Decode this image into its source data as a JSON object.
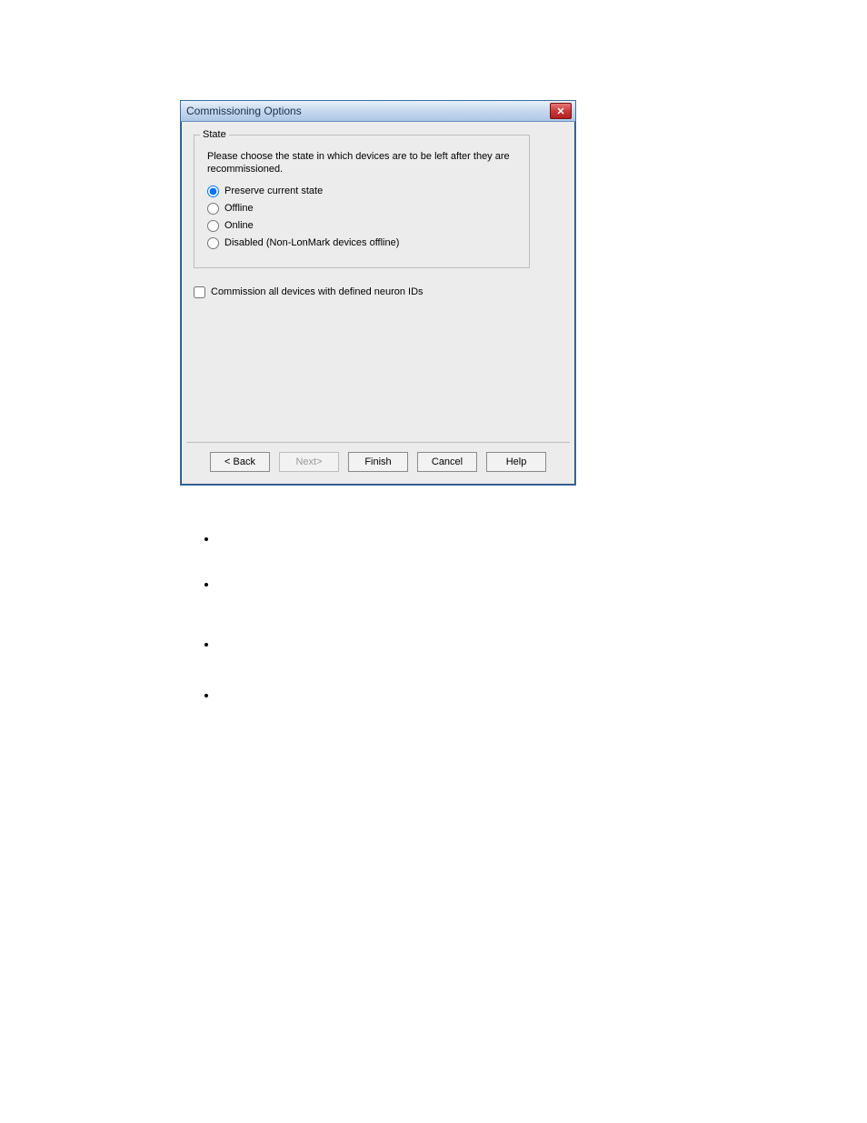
{
  "dialog": {
    "title": "Commissioning Options",
    "close_aria": "Close"
  },
  "group": {
    "legend": "State",
    "instruction": "Please choose the state in which devices are to be left after they are recommissioned.",
    "options": {
      "preserve": "Preserve current state",
      "offline": "Offline",
      "online": "Online",
      "disabled": "Disabled (Non-LonMark devices offline)"
    }
  },
  "checkbox": {
    "commission_all": "Commission all devices with defined neuron IDs"
  },
  "buttons": {
    "back": "< Back",
    "next": "Next>",
    "finish": "Finish",
    "cancel": "Cancel",
    "help": "Help"
  },
  "bullets": [
    "",
    "",
    "",
    ""
  ]
}
